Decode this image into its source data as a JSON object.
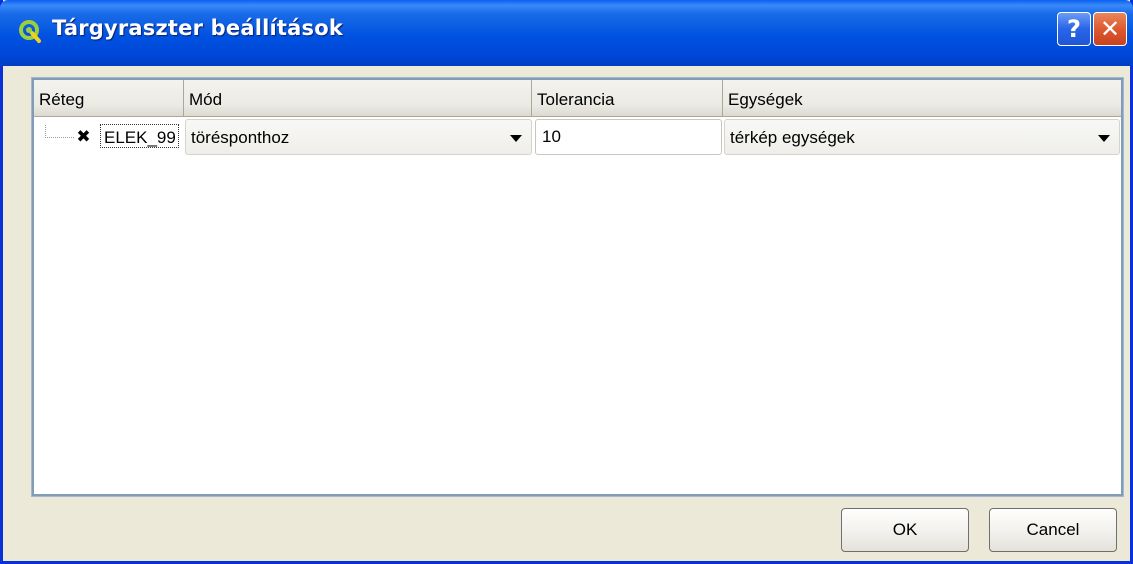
{
  "window": {
    "title": "Tárgyraszter beállítások",
    "icon": "qgis-logo-icon",
    "help_symbol": "?",
    "close_symbol": "✕"
  },
  "table": {
    "columns": [
      "Réteg",
      "Mód",
      "Tolerancia",
      "Egységek"
    ],
    "rows": [
      {
        "checked_symbol": "✖",
        "layer": "ELEK_99",
        "mode": "törésponthoz",
        "tolerance": "10",
        "units": "térkép egységek"
      }
    ]
  },
  "buttons": {
    "ok_label": "OK",
    "cancel_label": "Cancel"
  },
  "colors": {
    "titlebar": "#0052e0",
    "window_bg": "#ece9d8",
    "close_button": "#dd5b2f"
  }
}
